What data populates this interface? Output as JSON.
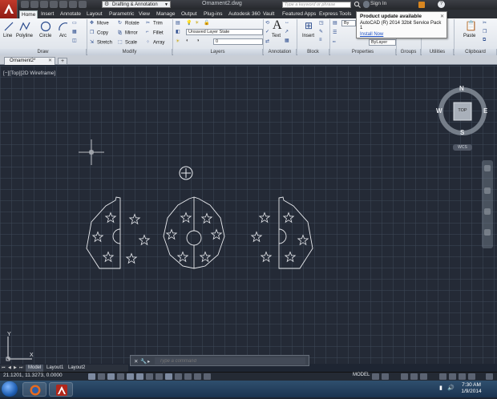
{
  "titlebar": {
    "workspace": "Drafting & Annotation",
    "document_title": "Ornament2.dwg",
    "search_placeholder": "Type a keyword or phrase",
    "signin": "Sign In"
  },
  "ribbon_tabs": [
    "Home",
    "Insert",
    "Annotate",
    "Layout",
    "Parametric",
    "View",
    "Manage",
    "Output",
    "Plug-ins",
    "Autodesk 360",
    "Vault",
    "Featured Apps",
    "Express Tools"
  ],
  "draw_panel": {
    "title": "Draw",
    "line": "Line",
    "polyline": "Polyline",
    "circle": "Circle",
    "arc": "Arc"
  },
  "modify_panel": {
    "title": "Modify",
    "move": "Move",
    "rotate": "Rotate",
    "trim": "Trim",
    "copy": "Copy",
    "mirror": "Mirror",
    "fillet": "Fillet",
    "stretch": "Stretch",
    "scale": "Scale",
    "array": "Array"
  },
  "layers_panel": {
    "title": "Layers",
    "layer_state": "Unsaved Layer State",
    "current_layer": "0"
  },
  "annotation_panel": {
    "title": "Annotation",
    "text": "Text"
  },
  "block_panel": {
    "title": "Block",
    "insert": "Insert"
  },
  "properties_panel": {
    "title": "Properties",
    "by": "By",
    "bylayer": "ByLayer"
  },
  "groups_panel": {
    "title": "Groups"
  },
  "utilities_panel": {
    "title": "Utilities"
  },
  "clipboard_panel": {
    "title": "Clipboard",
    "paste": "Paste"
  },
  "notification": {
    "title": "Product update available",
    "message": "AutoCAD (R) 2014 32bit Service Pack 1",
    "link": "Install Now"
  },
  "file_tab": {
    "label": "Ornament2*"
  },
  "viewport_label": "[−][Top][2D Wireframe]",
  "viewcube": {
    "n": "N",
    "s": "S",
    "e": "E",
    "w": "W",
    "top": "TOP",
    "wcs": "WCS"
  },
  "ucs": {
    "x": "X",
    "y": "Y"
  },
  "layout_tabs": [
    "Model",
    "Layout1",
    "Layout2"
  ],
  "command_line": {
    "placeholder": "Type a command"
  },
  "status": {
    "coords": "21.1201, 11.3273, 0.0000",
    "model": "MODEL"
  },
  "clock": {
    "time": "7:30 AM",
    "date": "1/9/2014"
  },
  "colors": {
    "canvas": "#242a36",
    "linework": "#e8eaee",
    "app_red": "#c0392b",
    "link_blue": "#1b4fc4"
  }
}
